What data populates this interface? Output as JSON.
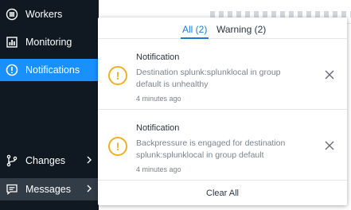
{
  "sidebar": {
    "items": [
      {
        "label": "Workers",
        "icon": "workers-icon"
      },
      {
        "label": "Monitoring",
        "icon": "monitoring-icon"
      },
      {
        "label": "Notifications",
        "icon": "alert-circle-icon",
        "active": true
      },
      {
        "label": "Changes",
        "icon": "git-branch-icon"
      },
      {
        "label": "Messages",
        "icon": "message-icon"
      }
    ],
    "active_color": "#1a90ff",
    "background": "#101921"
  },
  "popover": {
    "tabs": [
      {
        "label": "All (2)",
        "active": true
      },
      {
        "label": "Warning (2)",
        "active": false
      }
    ],
    "notifications": [
      {
        "title": "Notification",
        "message": "Destination splunk:splunklocal in group default is unhealthy",
        "time": "4 minutes ago",
        "icon": "warning-icon"
      },
      {
        "title": "Notification",
        "message": "Backpressure is engaged for destination splunk:splunklocal in group default",
        "time": "4 minutes ago",
        "icon": "warning-icon"
      }
    ],
    "clear_all_label": "Clear All",
    "warning_color": "#f2b01e",
    "accent_color": "#1a7cd6"
  }
}
